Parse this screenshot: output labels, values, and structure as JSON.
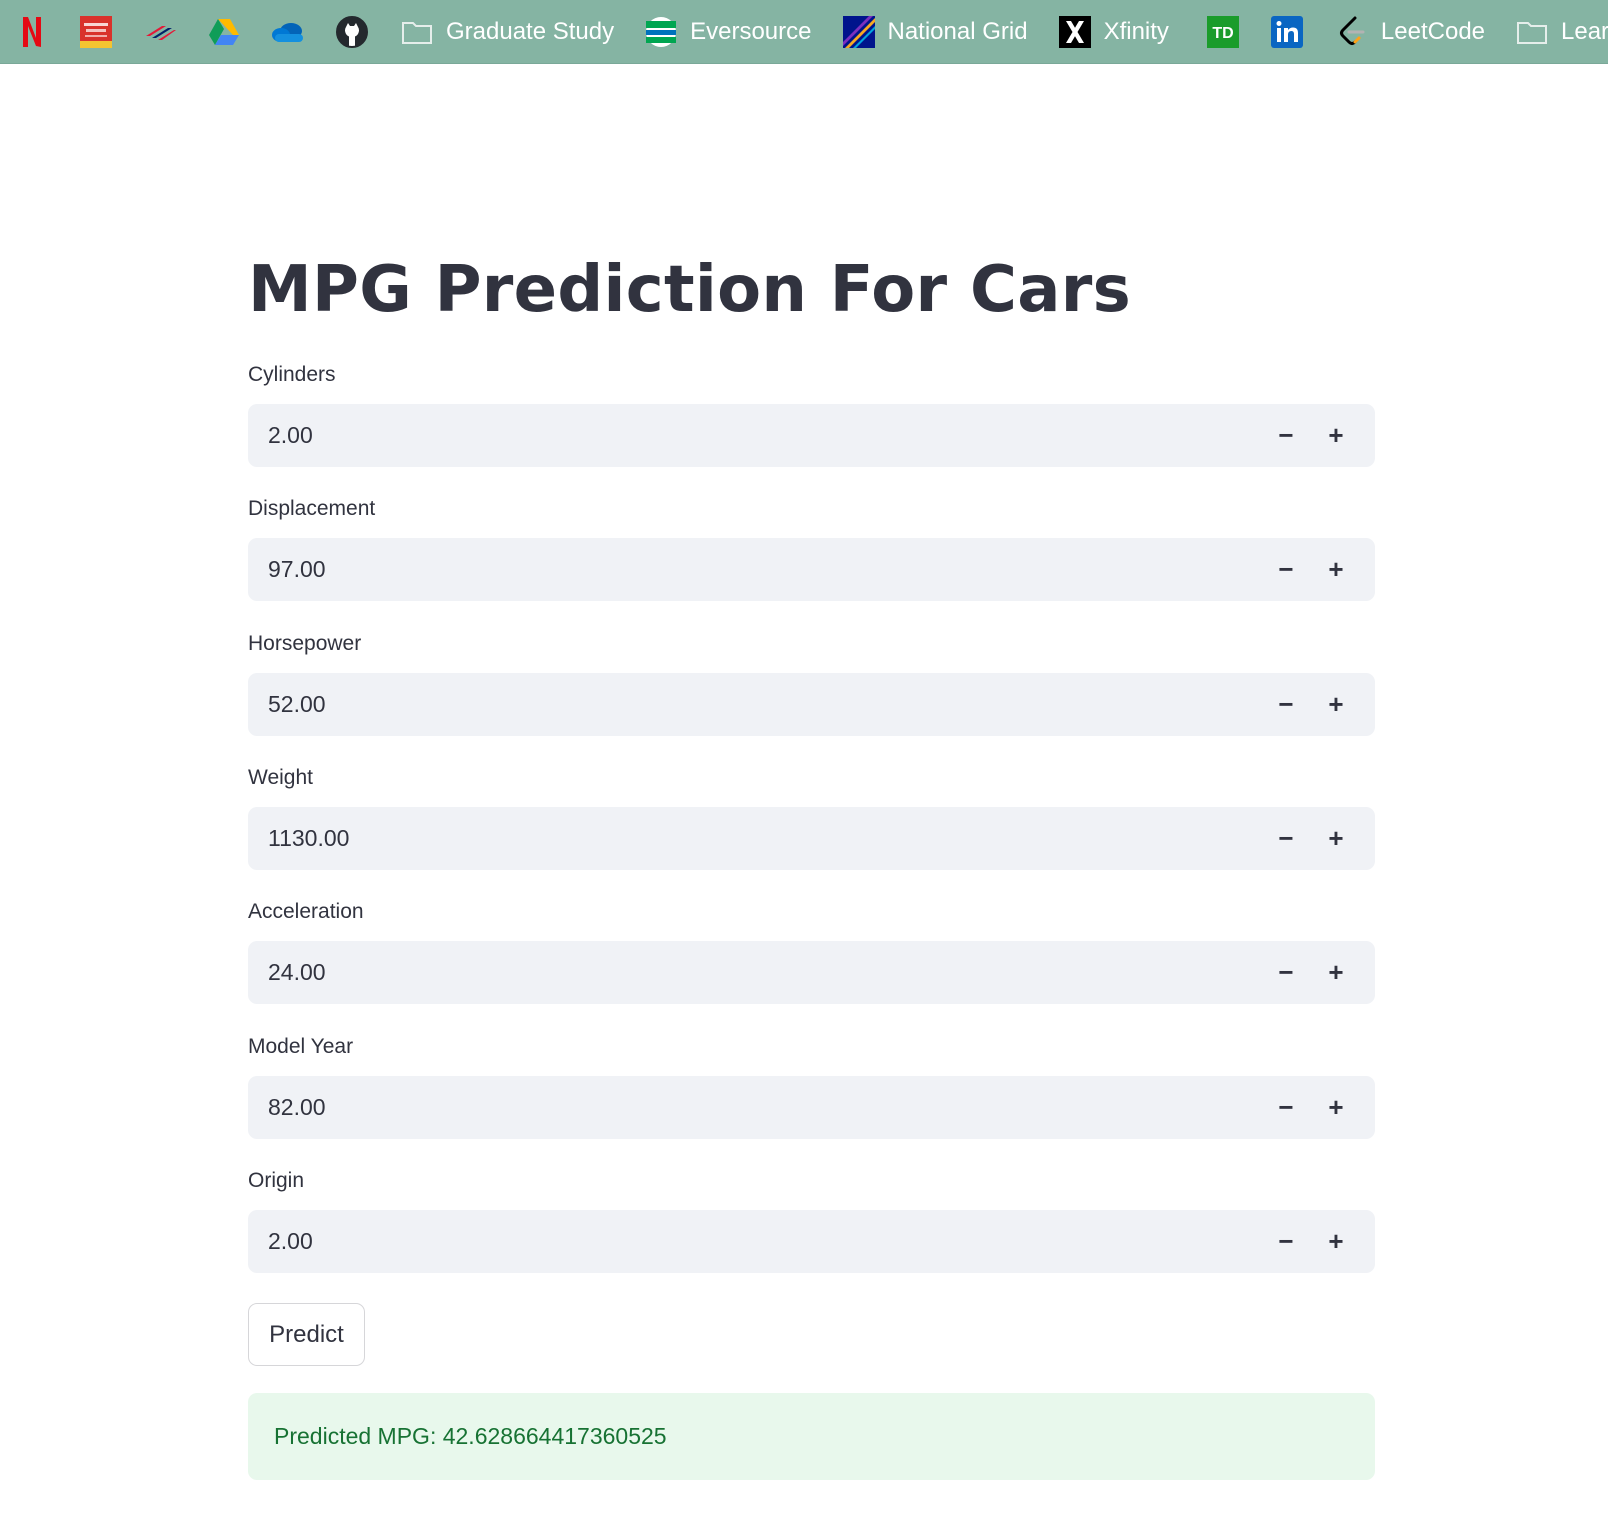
{
  "bookmarks": [
    {
      "icon": "netflix-icon",
      "label": ""
    },
    {
      "icon": "red-banner-site-icon",
      "label": ""
    },
    {
      "icon": "bank-of-america-icon",
      "label": ""
    },
    {
      "icon": "google-drive-icon",
      "label": ""
    },
    {
      "icon": "onedrive-icon",
      "label": ""
    },
    {
      "icon": "github-icon",
      "label": ""
    },
    {
      "icon": "folder-icon",
      "label": "Graduate Study"
    },
    {
      "icon": "eversource-icon",
      "label": "Eversource"
    },
    {
      "icon": "national-grid-icon",
      "label": "National Grid"
    },
    {
      "icon": "x-icon",
      "label": "Xfinity"
    },
    {
      "icon": "td-bank-icon",
      "label": ""
    },
    {
      "icon": "linkedin-icon",
      "label": ""
    },
    {
      "icon": "leetcode-icon",
      "label": "LeetCode"
    },
    {
      "icon": "folder-icon",
      "label": "Learn"
    }
  ],
  "page": {
    "title": "MPG Prediction For Cars"
  },
  "fields": [
    {
      "label": "Cylinders",
      "value": "2.00"
    },
    {
      "label": "Displacement",
      "value": "97.00"
    },
    {
      "label": "Horsepower",
      "value": "52.00"
    },
    {
      "label": "Weight",
      "value": "1130.00"
    },
    {
      "label": "Acceleration",
      "value": "24.00"
    },
    {
      "label": "Model Year",
      "value": "82.00"
    },
    {
      "label": "Origin",
      "value": "2.00"
    }
  ],
  "stepper": {
    "minus": "−",
    "plus": "+"
  },
  "actions": {
    "predict_label": "Predict"
  },
  "result": {
    "text": "Predicted MPG: 42.628664417360525"
  },
  "colors": {
    "bookmarks_bar": "#85b4a3",
    "text": "#31333f",
    "input_bg": "#f0f2f6",
    "success_bg": "#e8f8ec",
    "success_text": "#177233"
  }
}
